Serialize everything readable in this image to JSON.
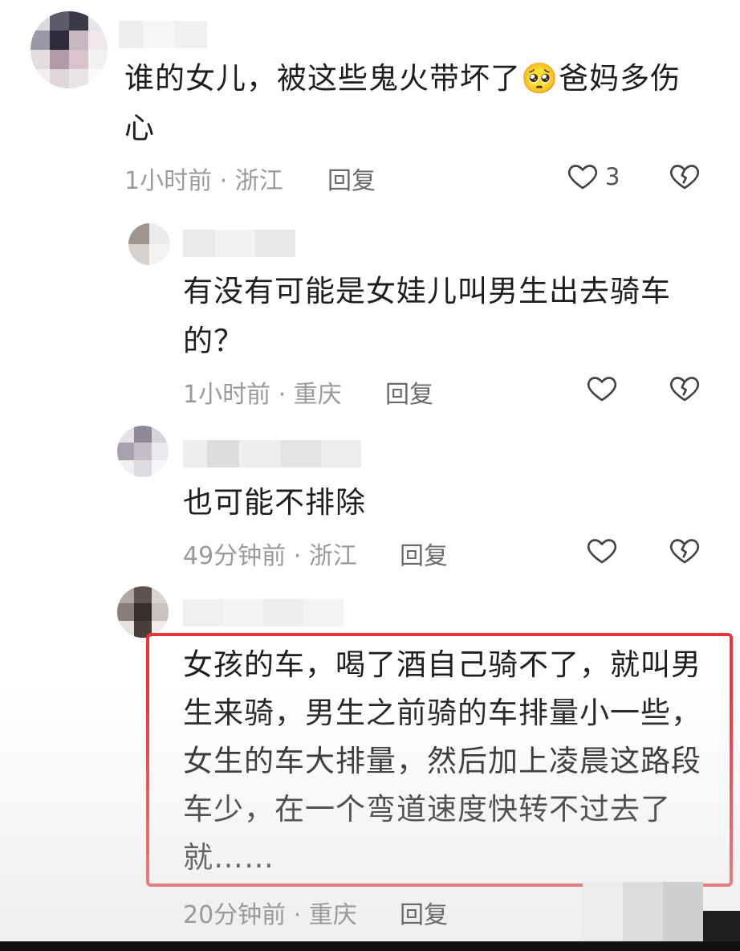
{
  "comments": [
    {
      "text_line1": "谁的女儿，被这些鬼火带坏了🥺爸妈多伤",
      "text_line2": "心",
      "meta": "1小时前 · 浙江",
      "reply_label": "回复",
      "like_count": "3"
    },
    {
      "text_line1": "有没有可能是女娃儿叫男生出去骑车",
      "text_line2": "的？",
      "meta": "1小时前 · 重庆",
      "reply_label": "回复"
    },
    {
      "text_line1": "也可能不排除",
      "meta": "49分钟前 · 浙江",
      "reply_label": "回复"
    },
    {
      "lines": [
        "女孩的车，喝了酒自己骑不了，就叫男",
        "生来骑，男生之前骑的车排量小一些，",
        "女生的车大排量，然后加上凌晨这路段",
        "车少，在一个弯道速度快转不过去了",
        "就……"
      ],
      "meta": "20分钟前 · 重庆",
      "reply_label": "回复"
    }
  ],
  "icons": {
    "like": "heart-outline-icon",
    "dislike": "broken-heart-icon"
  },
  "colors": {
    "highlight_border": "#e8333a",
    "meta_text": "#9a9a9a"
  }
}
